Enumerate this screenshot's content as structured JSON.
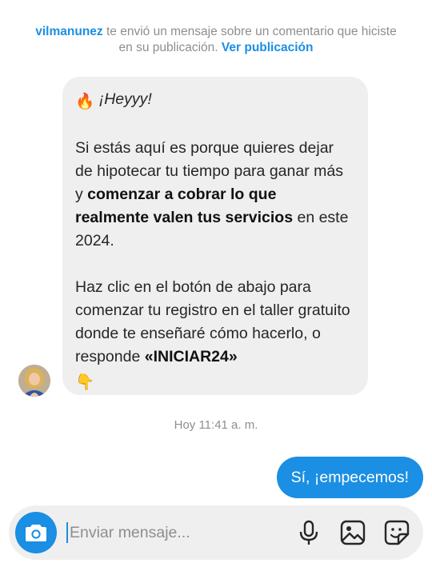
{
  "notice": {
    "username": "vilmanunez",
    "text": " te envió un mensaje sobre un comentario que hiciste en su publicación. ",
    "link": "Ver publicación"
  },
  "incoming": {
    "greeting_emoji": "🔥",
    "greeting": "¡Heyyy!",
    "p1_start": "Si estás aquí es porque quieres dejar de hipotecar tu tiempo para ganar más y ",
    "p1_bold": "comenzar a cobrar lo que realmente valen tus servicios",
    "p1_end": " en este 2024.",
    "p2_start": "Haz clic en el botón de abajo para comenzar tu registro en el taller gratuito donde te enseñaré cómo hacerlo, o responde ",
    "p2_bold": "«INICIAR24»",
    "p2_emoji": "👇"
  },
  "timestamp": "Hoy 11:41 a. m.",
  "outgoing": {
    "text": "Sí, ¡empecemos!"
  },
  "composer": {
    "placeholder": "Enviar mensaje...",
    "icons": [
      "camera-icon",
      "microphone-icon",
      "gallery-icon",
      "sticker-icon"
    ]
  },
  "colors": {
    "accent": "#1a8fe3",
    "bubble": "#efefef",
    "muted": "#8e8e8e"
  }
}
